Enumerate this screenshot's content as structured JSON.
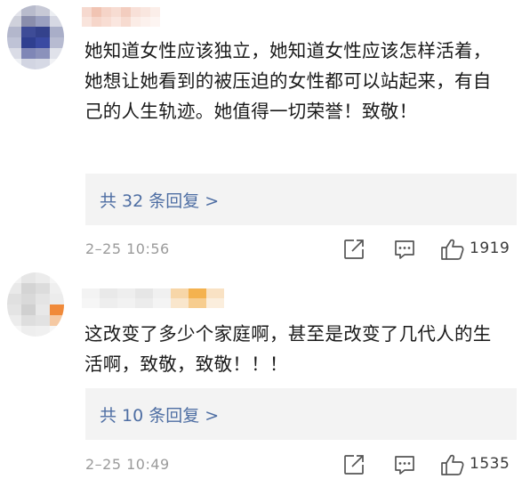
{
  "comments": [
    {
      "text": "她知道女性应该独立，她知道女性应该怎样活着，她想让她看到的被压迫的女性都可以站起来，有自己的人生轨迹。她值得一切荣誉！致敬！",
      "reply_link": "共 32 条回复 >",
      "timestamp": "2–25 10:56",
      "like_count": "1919",
      "icons": {
        "share": "share-icon",
        "reply": "comment-icon",
        "like": "thumbs-up-icon"
      }
    },
    {
      "text": "这改变了多少个家庭啊，甚至是改变了几代人的生活啊，致敬，致敬！！！",
      "reply_link": "共 10 条回复 >",
      "timestamp": "2–25 10:49",
      "like_count": "1535",
      "icons": {
        "share": "share-icon",
        "reply": "comment-icon",
        "like": "thumbs-up-icon"
      }
    }
  ],
  "colors": {
    "link": "#4e6ea3",
    "body_text": "#1a1a1a",
    "meta_text": "#9b9b9b",
    "reply_box_bg": "#f3f3f3"
  }
}
